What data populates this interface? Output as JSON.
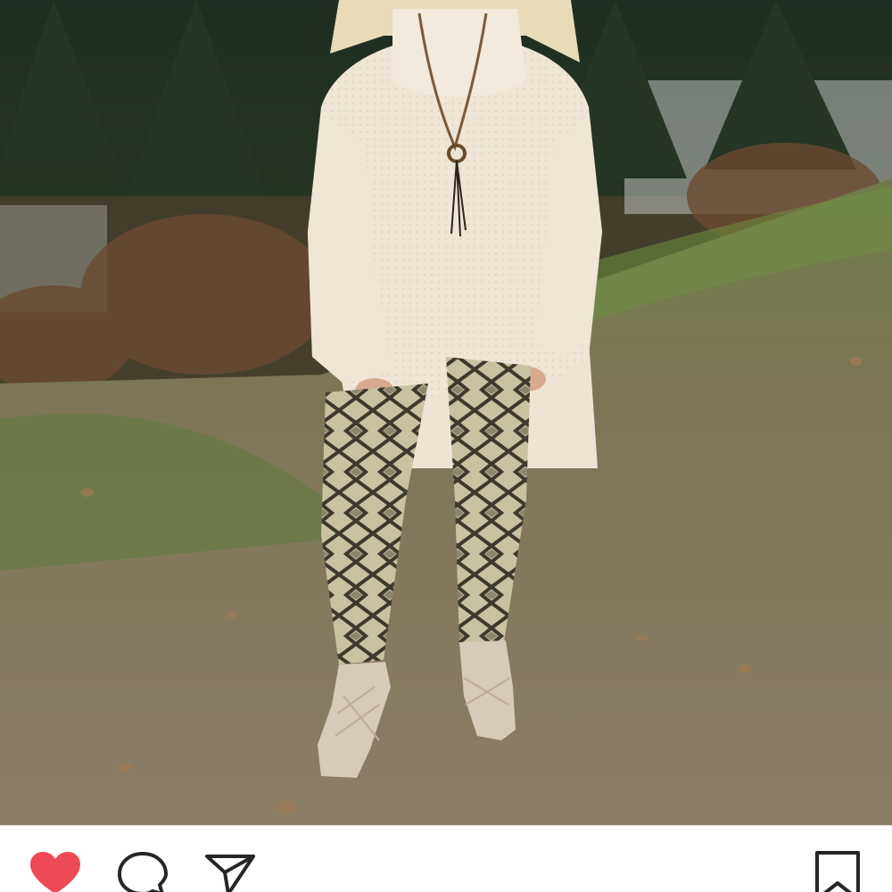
{
  "post": {
    "image_icon": "photo-outdoor-outfit",
    "liked": true
  },
  "actions": {
    "like_icon": "heart-icon",
    "comment_icon": "comment-icon",
    "share_icon": "paper-plane-icon",
    "save_icon": "bookmark-icon"
  },
  "colors": {
    "like_active": "#ed4956",
    "icon_stroke": "#262626",
    "background": "#ffffff"
  }
}
